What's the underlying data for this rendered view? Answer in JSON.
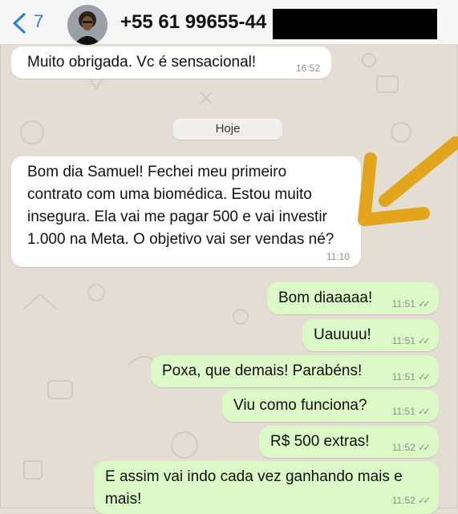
{
  "header": {
    "back_count": "7",
    "contact_name": "+55 61 99655-44"
  },
  "date_separator": "Hoje",
  "messages": [
    {
      "direction": "in",
      "text": "Muito obrigada.  Vc é sensacional!",
      "time": "16:52"
    },
    {
      "direction": "in",
      "lines": [
        "Bom dia Samuel! Fechei meu primeiro",
        "contrato com uma biomédica. Estou muito",
        "insegura. Ela vai me pagar 500 e vai investir",
        "1.000 na Meta. O objetivo vai ser vendas né?"
      ],
      "time": "11:10"
    },
    {
      "direction": "out",
      "text": "Bom diaaaaa!",
      "time": "11:51"
    },
    {
      "direction": "out",
      "text": "Uauuuu!",
      "time": "11:51"
    },
    {
      "direction": "out",
      "text": "Poxa, que demais! Parabéns!",
      "time": "11:51"
    },
    {
      "direction": "out",
      "text": "Viu como funciona?",
      "time": "11:51"
    },
    {
      "direction": "out",
      "text": "R$ 500 extras!",
      "time": "11:52"
    },
    {
      "direction": "out",
      "lines": [
        "E assim vai indo cada vez ganhando mais e",
        "mais!"
      ],
      "time": "11:52"
    }
  ],
  "colors": {
    "incoming_bubble": "#ffffff",
    "outgoing_bubble": "#dcf8c6",
    "accent": "#2a7fd6",
    "annotation_arrow": "#e2a51c"
  },
  "icons": {
    "back": "chevron-left-icon",
    "read_receipt": "double-check-icon"
  }
}
